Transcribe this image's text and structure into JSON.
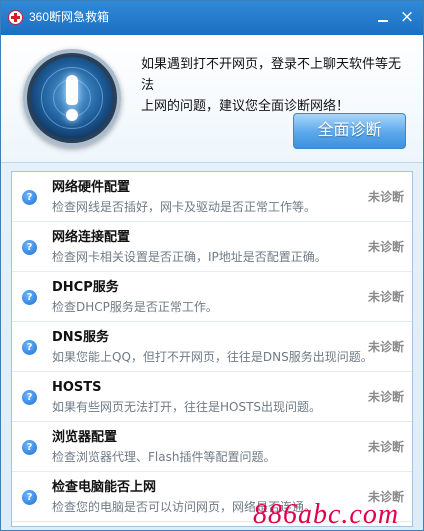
{
  "window": {
    "title": "360断网急救箱",
    "minimize_symbol": "",
    "close_symbol": "×"
  },
  "hero": {
    "message_line1": "如果遇到打不开网页，登录不上聊天软件等无法",
    "message_line2": "上网的问题，建议您全面诊断网络！",
    "scan_button_label": "全面诊断",
    "alert_icon": "exclamation-radar-icon"
  },
  "items": [
    {
      "title": "网络硬件配置",
      "description": "检查网线是否插好，网卡及驱动是否正常工作等。",
      "status": "未诊断"
    },
    {
      "title": "网络连接配置",
      "description": "检查网卡相关设置是否正确，IP地址是否配置正确。",
      "status": "未诊断"
    },
    {
      "title": "DHCP服务",
      "description": "检查DHCP服务是否正常工作。",
      "status": "未诊断"
    },
    {
      "title": "DNS服务",
      "description": "如果您能上QQ，但打不开网页，往往是DNS服务出现问题。",
      "status": "未诊断"
    },
    {
      "title": "HOSTS",
      "description": "如果有些网页无法打开，往往是HOSTS出现问题。",
      "status": "未诊断"
    },
    {
      "title": "浏览器配置",
      "description": "检查浏览器代理、Flash插件等配置问题。",
      "status": "未诊断"
    },
    {
      "title": "检查电脑能否上网",
      "description": "检查您的电脑是否可以访问网页，网络是否连通。",
      "status": "未诊断"
    }
  ],
  "watermark": "886abc.com",
  "colors": {
    "titlebar": "#1d6fc1",
    "accent_button": "#5aa8ec",
    "status_text": "#8a8a8a",
    "watermark": "#e0004d"
  }
}
